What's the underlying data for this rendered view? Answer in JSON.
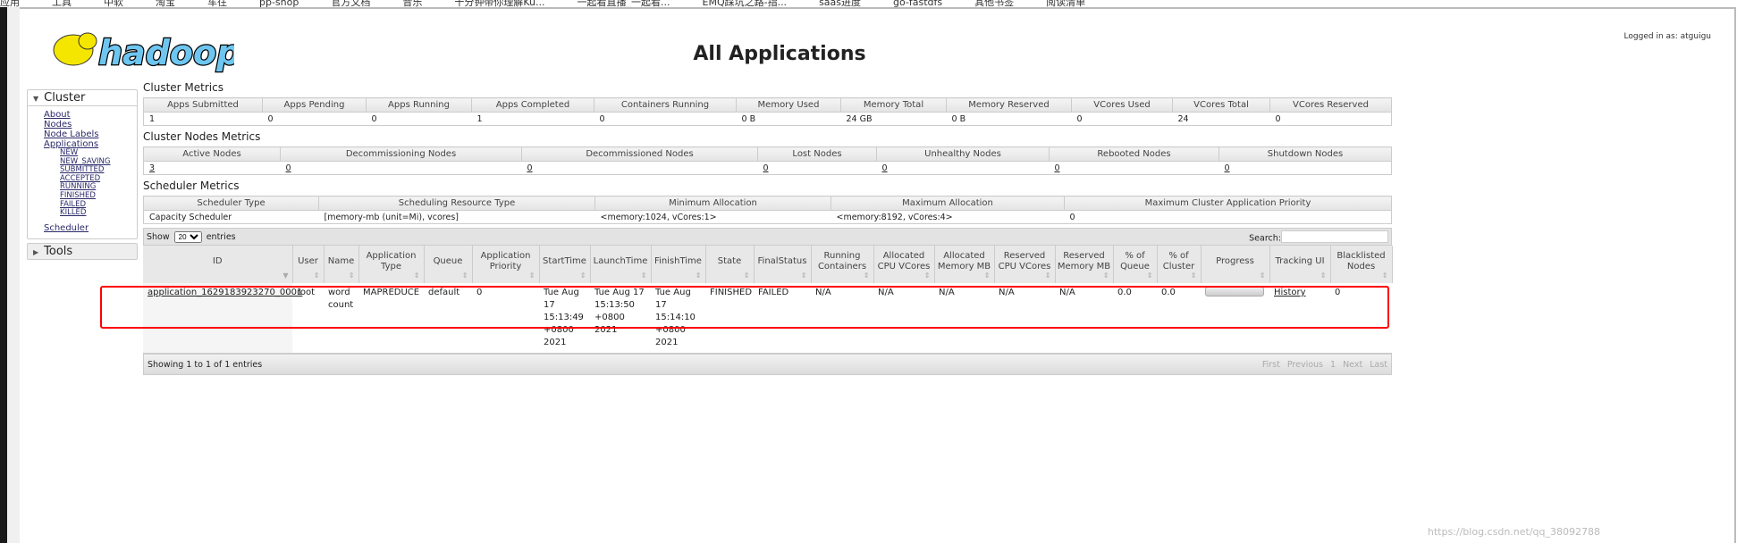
{
  "bookmarks": [
    "应用",
    "工具",
    "中软",
    "淘宝",
    "车往",
    "pp-shop",
    "官方文档",
    "音乐",
    "十分钟带你理解Ku...",
    "一起看直播_一起看...",
    "EMQ踩坑之路-指...",
    "saas进度",
    "go-fastdfs",
    "其他书签",
    "阅读清单"
  ],
  "header": {
    "title": "All Applications",
    "logged_in": "Logged in as: atguigu",
    "logo": "hadoop"
  },
  "sidebar": {
    "cluster": "Cluster",
    "links": [
      "About",
      "Nodes",
      "Node Labels",
      "Applications"
    ],
    "states": [
      "NEW",
      "NEW_SAVING",
      "SUBMITTED",
      "ACCEPTED",
      "RUNNING",
      "FINISHED",
      "FAILED",
      "KILLED"
    ],
    "scheduler": "Scheduler",
    "tools": "Tools"
  },
  "cluster_metrics": {
    "title": "Cluster Metrics",
    "headers": [
      "Apps Submitted",
      "Apps Pending",
      "Apps Running",
      "Apps Completed",
      "Containers Running",
      "Memory Used",
      "Memory Total",
      "Memory Reserved",
      "VCores Used",
      "VCores Total",
      "VCores Reserved"
    ],
    "values": [
      "1",
      "0",
      "0",
      "1",
      "0",
      "0 B",
      "24 GB",
      "0 B",
      "0",
      "24",
      "0"
    ]
  },
  "nodes_metrics": {
    "title": "Cluster Nodes Metrics",
    "headers": [
      "Active Nodes",
      "Decommissioning Nodes",
      "Decommissioned Nodes",
      "Lost Nodes",
      "Unhealthy Nodes",
      "Rebooted Nodes",
      "Shutdown Nodes"
    ],
    "values": [
      "3",
      "0",
      "0",
      "0",
      "0",
      "0",
      "0"
    ]
  },
  "scheduler_metrics": {
    "title": "Scheduler Metrics",
    "headers": [
      "Scheduler Type",
      "Scheduling Resource Type",
      "Minimum Allocation",
      "Maximum Allocation",
      "Maximum Cluster Application Priority"
    ],
    "values": [
      "Capacity Scheduler",
      "[memory-mb (unit=Mi), vcores]",
      "<memory:1024, vCores:1>",
      "<memory:8192, vCores:4>",
      "0"
    ]
  },
  "apps": {
    "show": "Show",
    "entries_value": "20",
    "entries": "entries",
    "search": "Search:",
    "headers": [
      "ID",
      "User",
      "Name",
      "Application Type",
      "Queue",
      "Application Priority",
      "StartTime",
      "LaunchTime",
      "FinishTime",
      "State",
      "FinalStatus",
      "Running Containers",
      "Allocated CPU VCores",
      "Allocated Memory MB",
      "Reserved CPU VCores",
      "Reserved Memory MB",
      "% of Queue",
      "% of Cluster",
      "Progress",
      "Tracking UI",
      "Blacklisted Nodes"
    ],
    "row": {
      "id": "application_1629183923270_0001",
      "user": "root",
      "name": "word count",
      "type": "MAPREDUCE",
      "queue": "default",
      "priority": "0",
      "start": "Tue Aug 17 15:13:49 +0800 2021",
      "launch": "Tue Aug 17 15:13:50 +0800 2021",
      "finish": "Tue Aug 17 15:14:10 +0800 2021",
      "state": "FINISHED",
      "final": "FAILED",
      "running": "N/A",
      "alloc_cpu": "N/A",
      "alloc_mem": "N/A",
      "res_cpu": "N/A",
      "res_mem": "N/A",
      "pct_queue": "0.0",
      "pct_cluster": "0.0",
      "progress": 0,
      "tracking": "History",
      "blacklisted": "0"
    },
    "showing": "Showing 1 to 1 of 1 entries",
    "pager": [
      "First",
      "Previous",
      "1",
      "Next",
      "Last"
    ]
  },
  "watermark": "https://blog.csdn.net/qq_38092788",
  "colors": {
    "highlight": "#ff0000",
    "logo_yellow": "#f5e600",
    "logo_blue": "#6ec6f0"
  }
}
